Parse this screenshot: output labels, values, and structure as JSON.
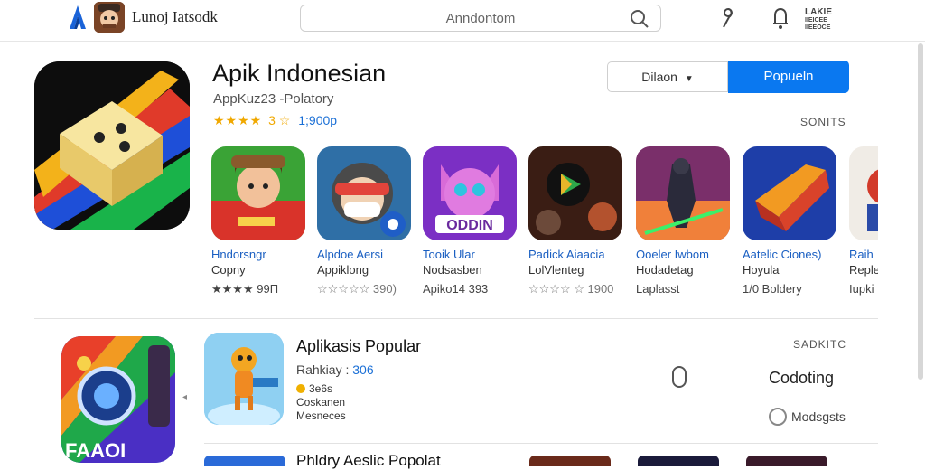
{
  "header": {
    "title": "Lunoj Iatsodk",
    "search_placeholder": "Anndontom",
    "language": [
      "LAKIE",
      "IIEICEE",
      "IIEEOCE"
    ]
  },
  "hero": {
    "title": "Apik Indonesian",
    "subtitle": "AppKuz23 -Polatory",
    "stars": "★★★★",
    "rating_num": "3",
    "rating_count": "1;900p",
    "secondary_button": "Dilaon",
    "primary_button": "Popueln",
    "section_label": "SONITS"
  },
  "apps": [
    {
      "name": "Hndorsngr",
      "developer": "Copny",
      "meta": "★★★★ 99П"
    },
    {
      "name": "Alpdoe Aersi",
      "developer": "Appiklong",
      "meta": "☆☆☆☆☆ 390)"
    },
    {
      "name": "Tooik Ular",
      "developer": "Nodsasben",
      "meta": "Apiko14 393"
    },
    {
      "name": "Padick Aiaacia",
      "developer": "LolVlenteg",
      "meta": "☆☆☆☆ ☆ 1900"
    },
    {
      "name": "Ooeler Iwbom",
      "developer": "Hodadetag",
      "meta": "Laplasst"
    },
    {
      "name": "Aatelic Ciones)",
      "developer": "Hoyula",
      "meta": "1/0 Boldery"
    },
    {
      "name": "Raih",
      "developer": "Reple",
      "meta": "Iupki"
    }
  ],
  "list": {
    "section_label": "SADKITC",
    "title": "Aplikasis Popular",
    "rank_label": "Rahkiay :",
    "rank_num": "306",
    "line1": "3e6s",
    "line2": "Coskanen",
    "line3": "Mesneces",
    "action": "Codoting",
    "option": "Modsgsts",
    "bottom_title": "Phldry Aeslic Popolat"
  },
  "colors": {
    "accent": "#0a78f0",
    "star": "#f0a800",
    "link": "#1a5fc2"
  }
}
